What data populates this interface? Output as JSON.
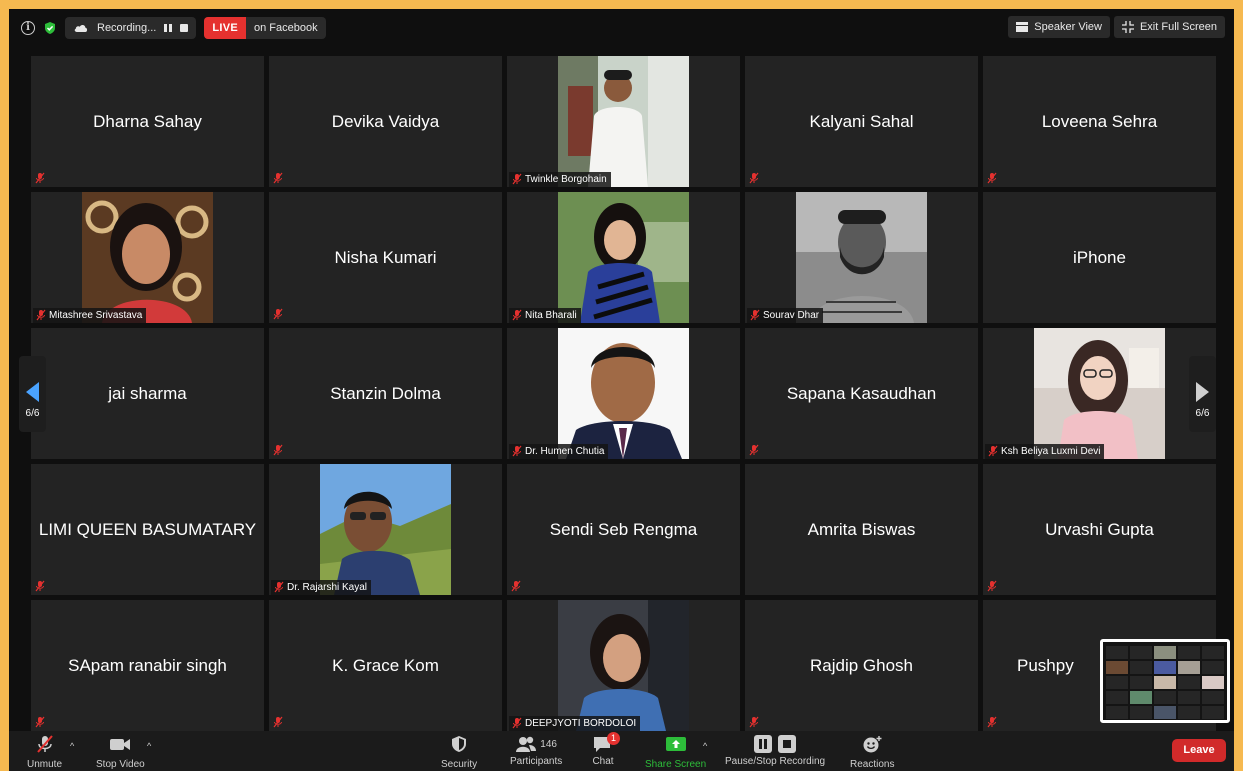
{
  "topbar": {
    "recording_label": "Recording...",
    "live_badge": "LIVE",
    "live_destination": "on Facebook",
    "speaker_view": "Speaker View",
    "exit_fullscreen": "Exit Full Screen"
  },
  "tiles": [
    {
      "name": "Dharna Sahay",
      "video": false
    },
    {
      "name": "Devika Vaidya",
      "video": false
    },
    {
      "name": "Twinkle Borgohain",
      "video": true
    },
    {
      "name": "Kalyani Sahal",
      "video": false
    },
    {
      "name": "Loveena Sehra",
      "video": false
    },
    {
      "name": "Mitashree Srivastava",
      "video": true
    },
    {
      "name": "Nisha Kumari",
      "video": false
    },
    {
      "name": "Nita Bharali",
      "video": true
    },
    {
      "name": "Sourav Dhar",
      "video": true
    },
    {
      "name": "iPhone",
      "video": false
    },
    {
      "name": "jai sharma",
      "video": false
    },
    {
      "name": "Stanzin Dolma",
      "video": false
    },
    {
      "name": "Dr. Humen Chutia",
      "video": true
    },
    {
      "name": "Sapana Kasaudhan",
      "video": false
    },
    {
      "name": "Ksh Beliya Luxmi Devi",
      "video": true
    },
    {
      "name": "LIMI QUEEN BASUMATARY",
      "video": false
    },
    {
      "name": "Dr. Rajarshi Kayal",
      "video": true
    },
    {
      "name": "Sendi Seb Rengma",
      "video": false
    },
    {
      "name": "Amrita Biswas",
      "video": false
    },
    {
      "name": "Urvashi Gupta",
      "video": false
    },
    {
      "name": "SApam ranabir singh",
      "video": false
    },
    {
      "name": "K. Grace Kom",
      "video": false
    },
    {
      "name": "DEEPJYOTI BORDOLOI",
      "video": true
    },
    {
      "name": "Rajdip Ghosh",
      "video": false
    },
    {
      "name": "Pushpy",
      "video": false
    }
  ],
  "pager": {
    "left": "6/6",
    "right": "6/6"
  },
  "toolbar": {
    "unmute": "Unmute",
    "stop_video": "Stop Video",
    "security": "Security",
    "participants": "Participants",
    "participants_count": "146",
    "chat": "Chat",
    "chat_badge": "1",
    "share_screen": "Share Screen",
    "recording": "Pause/Stop Recording",
    "reactions": "Reactions",
    "leave": "Leave"
  },
  "colors": {
    "border": "#f6b950",
    "live": "#e5312f",
    "share": "#2dbd3a",
    "leave": "#d12a2a",
    "nav_arrow": "#4aa3ff"
  }
}
